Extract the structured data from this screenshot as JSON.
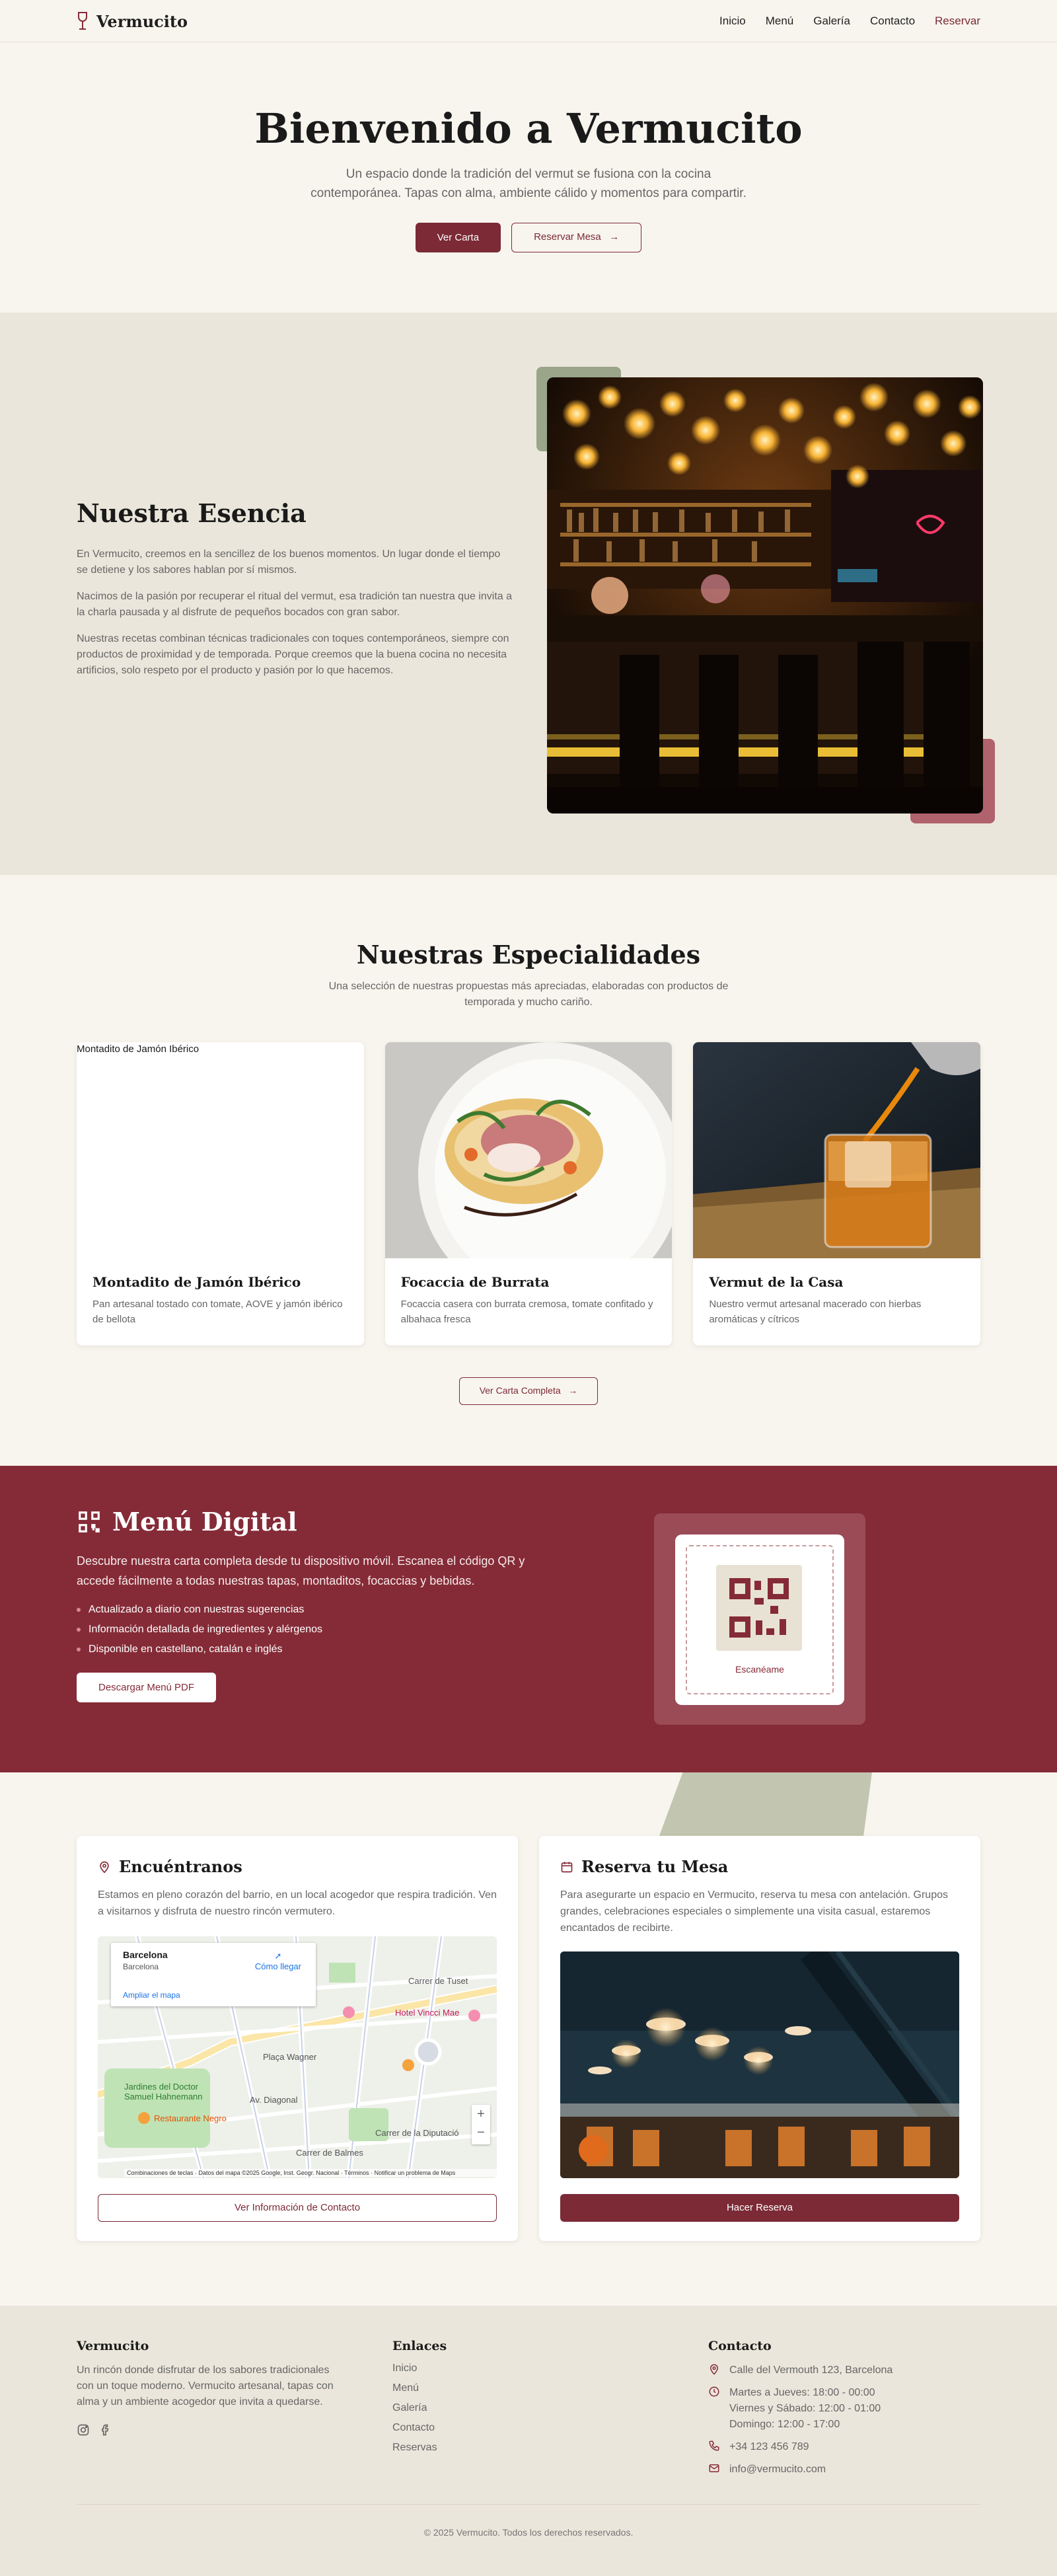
{
  "nav": {
    "brand": "Vermucito",
    "links": [
      "Inicio",
      "Menú",
      "Galería",
      "Contacto"
    ],
    "cta": "Reservar"
  },
  "hero": {
    "title": "Bienvenido a Vermucito",
    "subtitle_line1": "Un espacio donde la tradición del vermut se fusiona con la cocina",
    "subtitle_line2": "contemporánea. Tapas con alma, ambiente cálido y momentos para compartir.",
    "btn_primary": "Ver Carta",
    "btn_secondary": "Reservar Mesa"
  },
  "essence": {
    "title": "Nuestra Esencia",
    "p1": "En Vermucito, creemos en la sencillez de los buenos momentos. Un lugar donde el tiempo se detiene y los sabores hablan por sí mismos.",
    "p2": "Nacimos de la pasión por recuperar el ritual del vermut, esa tradición tan nuestra que invita a la charla pausada y al disfrute de pequeños bocados con gran sabor.",
    "p3": "Nuestras recetas combinan técnicas tradicionales con toques contemporáneos, siempre con productos de proximidad y de temporada. Porque creemos que la buena cocina no necesita artificios, solo respeto por el producto y pasión por lo que hacemos."
  },
  "specialties": {
    "title": "Nuestras Especialidades",
    "subtitle_line1": "Una selección de nuestras propuestas más apreciadas, elaboradas con productos de",
    "subtitle_line2": "temporada y mucho cariño.",
    "cards": [
      {
        "alt": "Montadito de Jamón Ibérico",
        "title": "Montadito de Jamón Ibérico",
        "desc": "Pan artesanal tostado con tomate, AOVE y jamón ibérico de bellota"
      },
      {
        "title": "Focaccia de Burrata",
        "desc": "Focaccia casera con burrata cremosa, tomate confitado y albahaca fresca"
      },
      {
        "title": "Vermut de la Casa",
        "desc": "Nuestro vermut artesanal macerado con hierbas aromáticas y cítricos"
      }
    ],
    "cta": "Ver Carta Completa"
  },
  "digital": {
    "title": "Menú Digital",
    "desc": "Descubre nuestra carta completa desde tu dispositivo móvil. Escanea el código QR y accede fácilmente a todas nuestras tapas, montaditos, focaccias y bebidas.",
    "features": [
      "Actualizado a diario con nuestras sugerencias",
      "Información detallada de ingredientes y alérgenos",
      "Disponible en castellano, catalán e inglés"
    ],
    "button": "Descargar Menú PDF",
    "qr_label": "Escanéame"
  },
  "location": {
    "title": "Encuéntranos",
    "desc": "Estamos en pleno corazón del barrio, en un local acogedor que respira tradición. Ven a visitarnos y disfruta de nuestro rincón vermutero.",
    "map": {
      "city": "Barcelona",
      "region": "Barcelona",
      "directions": "Cómo llegar",
      "expand": "Ampliar el mapa",
      "labels": [
        "Hotel Vincci Mae",
        "Plaça Wagner",
        "Jardines del Doctor Samuel Hahnemann",
        "Restaurante Negro",
        "Av. Diagonal",
        "Carrer de Tuset",
        "Carrer de Balmes",
        "Carrer de la Diputació"
      ],
      "footer": "Combinaciones de teclas · Datos del mapa ©2025 Google, Inst. Geogr. Nacional · Términos · Notificar un problema de Maps"
    },
    "button": "Ver Información de Contacto"
  },
  "reserve": {
    "title": "Reserva tu Mesa",
    "desc": "Para asegurarte un espacio en Vermucito, reserva tu mesa con antelación. Grupos grandes, celebraciones especiales o simplemente una visita casual, estaremos encantados de recibirte.",
    "button": "Hacer Reserva"
  },
  "footer": {
    "brand": "Vermucito",
    "about": "Un rincón donde disfrutar de los sabores tradicionales con un toque moderno. Vermucito artesanal, tapas con alma y un ambiente acogedor que invita a quedarse.",
    "links_title": "Enlaces",
    "links": [
      "Inicio",
      "Menú",
      "Galería",
      "Contacto",
      "Reservas"
    ],
    "contact_title": "Contacto",
    "address": "Calle del Vermouth 123, Barcelona",
    "hours": [
      "Martes a Jueves: 18:00 - 00:00",
      "Viernes y Sábado: 12:00 - 01:00",
      "Domingo: 12:00 - 17:00"
    ],
    "phone": "+34 123 456 789",
    "email": "info@vermucito.com",
    "copyright": "© 2025 Vermucito. Todos los derechos reservados."
  },
  "colors": {
    "primary": "#852b37",
    "background": "#f8f5ee",
    "beige": "#ebe6db",
    "sage": "#9aa58a"
  }
}
